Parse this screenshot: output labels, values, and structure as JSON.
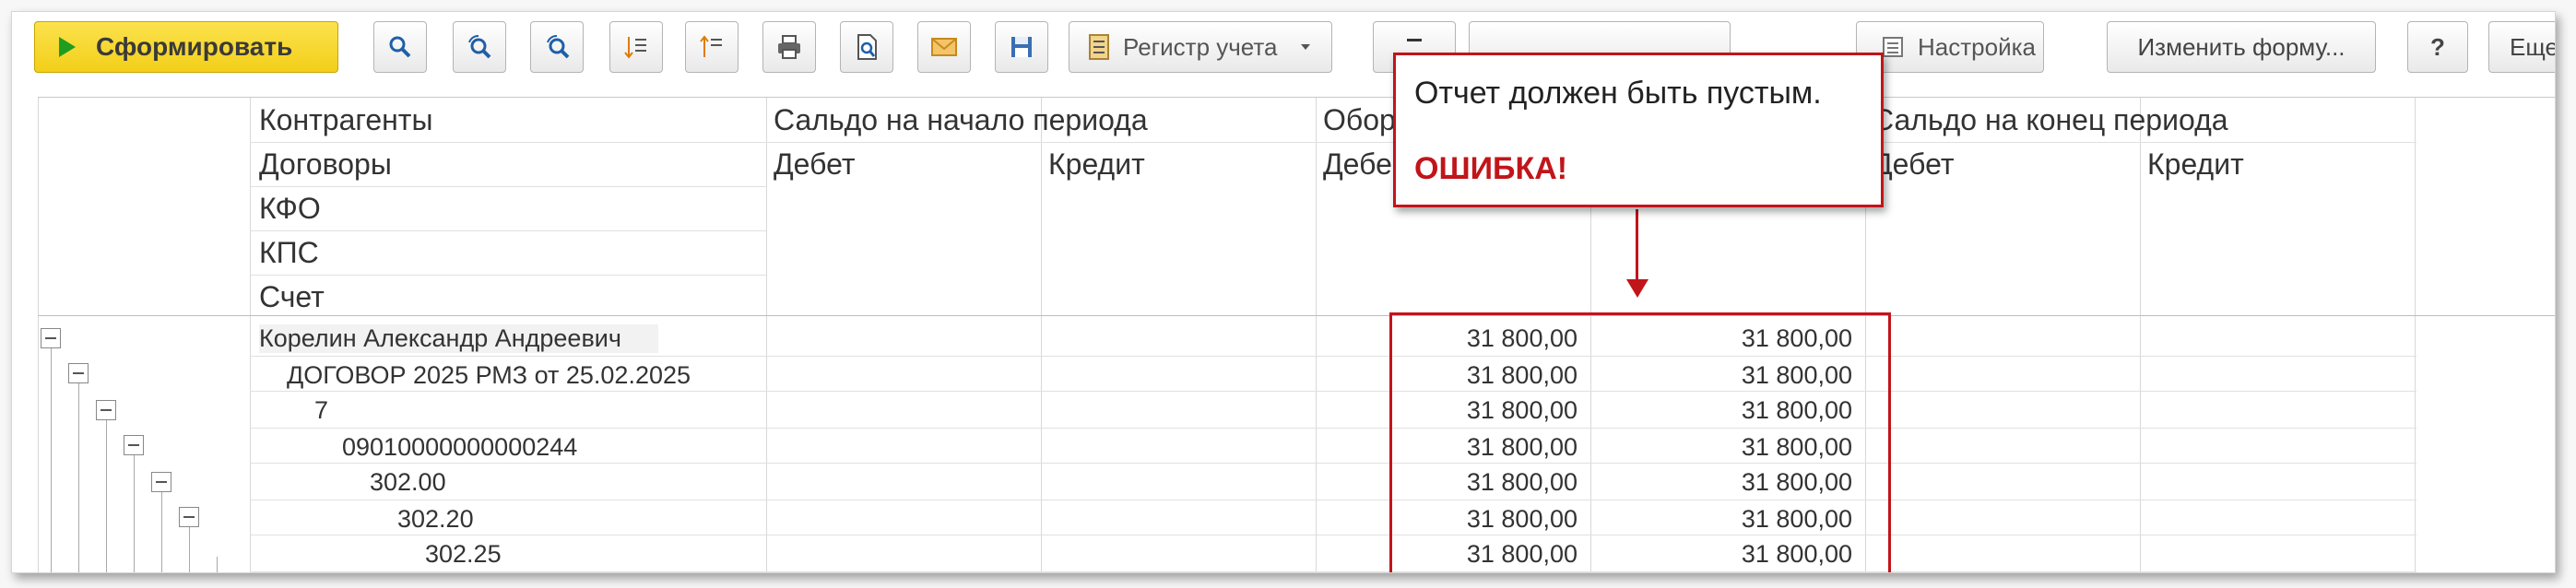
{
  "toolbar": {
    "generate_label": "Сформировать",
    "registry_label": "Регистр учета",
    "settings_label": "Настройка",
    "change_form_label": "Изменить форму...",
    "help_label": "?",
    "more_label": "Еще"
  },
  "table": {
    "header_hierarchy": [
      "Контрагенты",
      "Договоры",
      "КФО",
      "КПС",
      "Счет"
    ],
    "opening_balance": "Сальдо на начало периода",
    "turnover_partial": "Обор",
    "closing_balance_partial": "Сальдо на конец периода",
    "debit": "Дебет",
    "debit_partial": "Дебе",
    "debit_closing_partial": "Дебет",
    "credit": "Кредит",
    "rows": [
      {
        "label": "Корелин Александр Андреевич",
        "debit": "31 800,00",
        "credit": "31 800,00"
      },
      {
        "label": "ДОГОВОР 2025 РМЗ от 25.02.2025",
        "debit": "31 800,00",
        "credit": "31 800,00"
      },
      {
        "label": "7",
        "debit": "31 800,00",
        "credit": "31 800,00"
      },
      {
        "label": "09010000000000244",
        "debit": "31 800,00",
        "credit": "31 800,00"
      },
      {
        "label": "302.00",
        "debit": "31 800,00",
        "credit": "31 800,00"
      },
      {
        "label": "302.20",
        "debit": "31 800,00",
        "credit": "31 800,00"
      },
      {
        "label": "302.25",
        "debit": "31 800,00",
        "credit": "31 800,00"
      }
    ]
  },
  "annotation": {
    "message": "Отчет должен быть пустым.",
    "error": "ОШИБКА!",
    "color": "#c1151a"
  },
  "icons": [
    "search-icon",
    "search-next-icon",
    "search-prev-icon",
    "expand-groups-icon",
    "collapse-groups-icon",
    "print-icon",
    "preview-icon",
    "email-icon",
    "save-icon",
    "registry-icon",
    "settings-icon"
  ],
  "accent_yellow": "#f3cf19"
}
